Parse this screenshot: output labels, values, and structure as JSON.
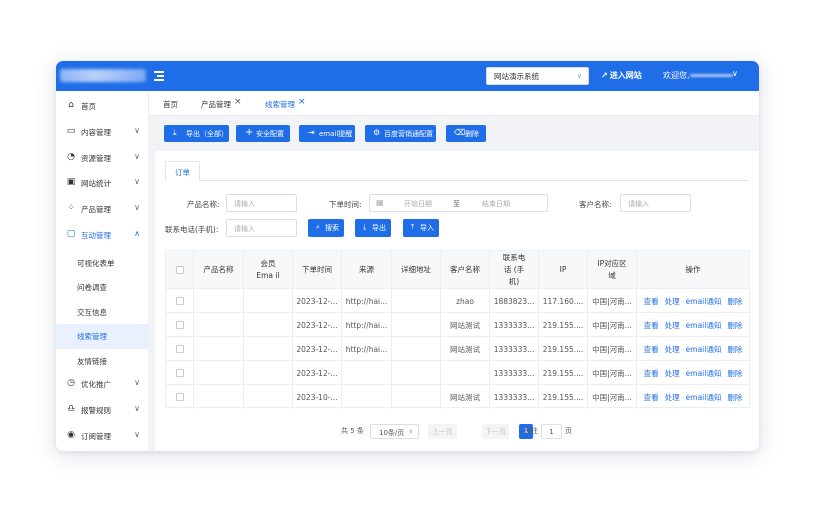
{
  "header": {
    "site_select": "网站演示系统",
    "enter_site": "进入网站",
    "welcome": "欢迎您,"
  },
  "sidebar": {
    "items": [
      {
        "label": "首页",
        "icon": "home-icon"
      },
      {
        "label": "内容管理",
        "icon": "document-icon"
      },
      {
        "label": "资源管理",
        "icon": "dashboard-icon"
      },
      {
        "label": "网站统计",
        "icon": "monitor-icon"
      },
      {
        "label": "产品管理",
        "icon": "grid-icon"
      },
      {
        "label": "互动管理",
        "icon": "chat-icon"
      },
      {
        "label": "优化推广",
        "icon": "chart-icon"
      },
      {
        "label": "报警规则",
        "icon": "alarm-icon"
      },
      {
        "label": "订阅管理",
        "icon": "eye-icon"
      }
    ],
    "sub_items": [
      {
        "label": "可视化表单"
      },
      {
        "label": "问卷调查"
      },
      {
        "label": "交互信息"
      },
      {
        "label": "线索管理"
      },
      {
        "label": "友情链接"
      }
    ]
  },
  "tabs": [
    {
      "label": "首页"
    },
    {
      "label": "产品管理"
    },
    {
      "label": "线索管理"
    }
  ],
  "toolbar": {
    "export_all": "导出（全部）",
    "security_config": "安全配置",
    "email_reminder": "email提醒",
    "baidu_config": "百度营销通配置",
    "delete": "删除"
  },
  "card_tab": "订单",
  "filters": {
    "product_label": "产品名称:",
    "product_placeholder": "请输入",
    "order_time_label": "下单时间:",
    "start_date": "开始日期",
    "range_sep": "至",
    "end_date": "结束日期",
    "customer_label": "客户名称:",
    "customer_placeholder": "请输入",
    "phone_label": "联系电话(手机):",
    "phone_placeholder": "请输入",
    "search": "搜索",
    "export": "导出",
    "import": "导入"
  },
  "table": {
    "headers": [
      "产品名称",
      "会员Ema il",
      "下单时间",
      "来源",
      "详细地址",
      "客户名称",
      "联系电话 (手机)",
      "IP",
      "IP对应区 域",
      "操作"
    ],
    "rows": [
      {
        "product": "",
        "email": "",
        "time": "2023-12-...",
        "source": "http://hai...",
        "address": "",
        "customer": "zhao",
        "phone": "1883823...",
        "ip": "117.160....",
        "region": "中国|河南..."
      },
      {
        "product": "",
        "email": "",
        "time": "2023-12-...",
        "source": "http://hai...",
        "address": "",
        "customer": "网站测试",
        "phone": "1333333...",
        "ip": "219.155....",
        "region": "中国|河南..."
      },
      {
        "product": "",
        "email": "",
        "time": "2023-12-...",
        "source": "http://hai...",
        "address": "",
        "customer": "网站测试",
        "phone": "1333333...",
        "ip": "219.155....",
        "region": "中国|河南..."
      },
      {
        "product": "",
        "email": "",
        "time": "2023-12-...",
        "source": "",
        "address": "",
        "customer": "",
        "phone": "1333333...",
        "ip": "219.155....",
        "region": "中国|河南..."
      },
      {
        "product": "",
        "email": "",
        "time": "2023-10-...",
        "source": "",
        "address": "",
        "customer": "网站测试",
        "phone": "1333333...",
        "ip": "219.155....",
        "region": "中国|河南..."
      }
    ],
    "actions": [
      "查看",
      "处理",
      "email通知",
      "删除"
    ]
  },
  "pagination": {
    "total": "共 5 条",
    "page_size": "10条/页",
    "prev": "上一页",
    "current": "1",
    "next": "下一页",
    "goto_label": "前往",
    "goto_value": "1",
    "page_unit": "页"
  },
  "colors": {
    "primary": "#1f6ee8",
    "sidebar_active_bg": "#e9f1ff"
  }
}
